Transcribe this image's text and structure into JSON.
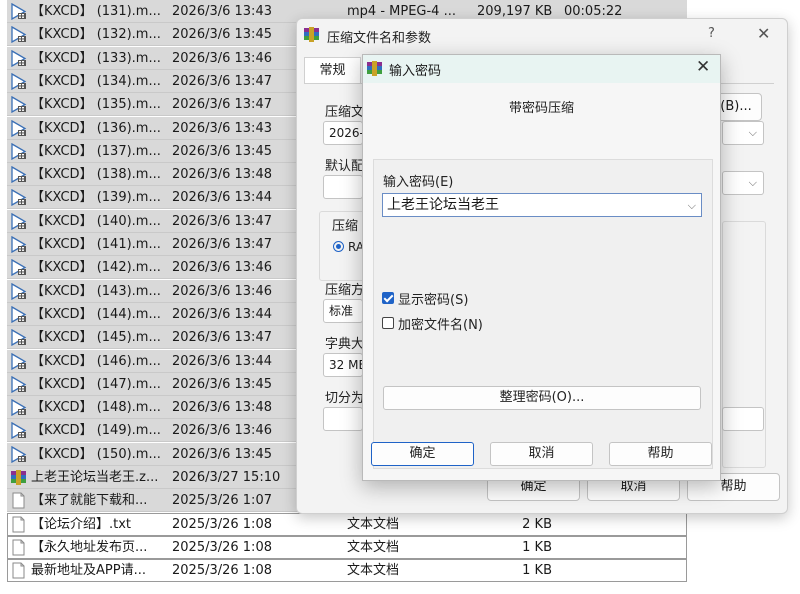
{
  "file_list": {
    "rows": [
      {
        "name": "【KXCD】 (131).m...",
        "date": "2026/3/6 13:43",
        "type": "mp4 - MPEG-4 ...",
        "size": "209,197 KB",
        "duration": "00:05:22",
        "icon": "video-file-icon",
        "selected": true
      },
      {
        "name": "【KXCD】 (132).m...",
        "date": "2026/3/6 13:45",
        "type": "",
        "size": "",
        "duration": "",
        "icon": "video-file-icon",
        "selected": true
      },
      {
        "name": "【KXCD】 (133).m...",
        "date": "2026/3/6 13:46",
        "type": "",
        "size": "",
        "duration": "",
        "icon": "video-file-icon",
        "selected": true
      },
      {
        "name": "【KXCD】 (134).m...",
        "date": "2026/3/6 13:47",
        "type": "",
        "size": "",
        "duration": "",
        "icon": "video-file-icon",
        "selected": true
      },
      {
        "name": "【KXCD】 (135).m...",
        "date": "2026/3/6 13:47",
        "type": "",
        "size": "",
        "duration": "",
        "icon": "video-file-icon",
        "selected": true
      },
      {
        "name": "【KXCD】 (136).m...",
        "date": "2026/3/6 13:43",
        "type": "",
        "size": "",
        "duration": "",
        "icon": "video-file-icon",
        "selected": true
      },
      {
        "name": "【KXCD】 (137).m...",
        "date": "2026/3/6 13:45",
        "type": "",
        "size": "",
        "duration": "",
        "icon": "video-file-icon",
        "selected": true
      },
      {
        "name": "【KXCD】 (138).m...",
        "date": "2026/3/6 13:48",
        "type": "",
        "size": "",
        "duration": "",
        "icon": "video-file-icon",
        "selected": true
      },
      {
        "name": "【KXCD】 (139).m...",
        "date": "2026/3/6 13:44",
        "type": "",
        "size": "",
        "duration": "",
        "icon": "video-file-icon",
        "selected": true
      },
      {
        "name": "【KXCD】 (140).m...",
        "date": "2026/3/6 13:47",
        "type": "",
        "size": "",
        "duration": "",
        "icon": "video-file-icon",
        "selected": true
      },
      {
        "name": "【KXCD】 (141).m...",
        "date": "2026/3/6 13:47",
        "type": "",
        "size": "",
        "duration": "",
        "icon": "video-file-icon",
        "selected": true
      },
      {
        "name": "【KXCD】 (142).m...",
        "date": "2026/3/6 13:46",
        "type": "",
        "size": "",
        "duration": "",
        "icon": "video-file-icon",
        "selected": true
      },
      {
        "name": "【KXCD】 (143).m...",
        "date": "2026/3/6 13:46",
        "type": "",
        "size": "",
        "duration": "",
        "icon": "video-file-icon",
        "selected": true
      },
      {
        "name": "【KXCD】 (144).m...",
        "date": "2026/3/6 13:44",
        "type": "",
        "size": "",
        "duration": "",
        "icon": "video-file-icon",
        "selected": true
      },
      {
        "name": "【KXCD】 (145).m...",
        "date": "2026/3/6 13:47",
        "type": "",
        "size": "",
        "duration": "",
        "icon": "video-file-icon",
        "selected": true
      },
      {
        "name": "【KXCD】 (146).m...",
        "date": "2026/3/6 13:44",
        "type": "",
        "size": "",
        "duration": "",
        "icon": "video-file-icon",
        "selected": true
      },
      {
        "name": "【KXCD】 (147).m...",
        "date": "2026/3/6 13:45",
        "type": "",
        "size": "",
        "duration": "",
        "icon": "video-file-icon",
        "selected": true
      },
      {
        "name": "【KXCD】 (148).m...",
        "date": "2026/3/6 13:48",
        "type": "",
        "size": "",
        "duration": "",
        "icon": "video-file-icon",
        "selected": true
      },
      {
        "name": "【KXCD】 (149).m...",
        "date": "2026/3/6 13:46",
        "type": "",
        "size": "",
        "duration": "",
        "icon": "video-file-icon",
        "selected": true
      },
      {
        "name": "【KXCD】 (150).m...",
        "date": "2026/3/6 13:45",
        "type": "",
        "size": "",
        "duration": "",
        "icon": "video-file-icon",
        "selected": true
      },
      {
        "name": "上老王论坛当老王.z...",
        "date": "2026/3/27 15:10",
        "type": "",
        "size": "",
        "duration": "",
        "icon": "winrar-archive-icon",
        "selected": true
      },
      {
        "name": "【来了就能下载和...",
        "date": "2025/3/26 1:07",
        "type": "",
        "size": "",
        "duration": "",
        "icon": "text-file-icon",
        "selected": true
      },
      {
        "name": "【论坛介绍】.txt",
        "date": "2025/3/26 1:08",
        "type": "文本文档",
        "size": "2 KB",
        "duration": "",
        "icon": "text-file-icon",
        "selected": false
      },
      {
        "name": "【永久地址发布页...",
        "date": "2025/3/26 1:08",
        "type": "文本文档",
        "size": "1 KB",
        "duration": "",
        "icon": "text-file-icon",
        "selected": false
      },
      {
        "name": "最新地址及APP请...",
        "date": "2025/3/26 1:08",
        "type": "文本文档",
        "size": "1 KB",
        "duration": "",
        "icon": "text-file-icon",
        "selected": false
      }
    ]
  },
  "archive_window": {
    "title": "压缩文件名和参数",
    "help_glyph": "?",
    "close_glyph": "✕",
    "tab_general": "常规",
    "archive_name_label": "压缩文",
    "archive_name_value": "2026-3",
    "browse_button": "(B)...",
    "default_profile_label": "默认配",
    "format_group_label": "压缩",
    "format_rar": "RA",
    "method_label": "压缩方",
    "method_value": "标准",
    "dict_label": "字典大",
    "dict_value": "32 MB",
    "split_label": "切分为",
    "ok_button": "确定",
    "cancel_button": "取消",
    "help_button": "帮助"
  },
  "password_dialog": {
    "title": "输入密码",
    "close_glyph": "✕",
    "heading": "带密码压缩",
    "password_label": "输入密码(E)",
    "password_value": "上老王论坛当老王",
    "show_password_label": "显示密码(S)",
    "show_password_checked": true,
    "encrypt_names_label": "加密文件名(N)",
    "encrypt_names_checked": false,
    "organize_button": "整理密码(O)...",
    "ok_button": "确定",
    "cancel_button": "取消",
    "help_button": "帮助"
  }
}
